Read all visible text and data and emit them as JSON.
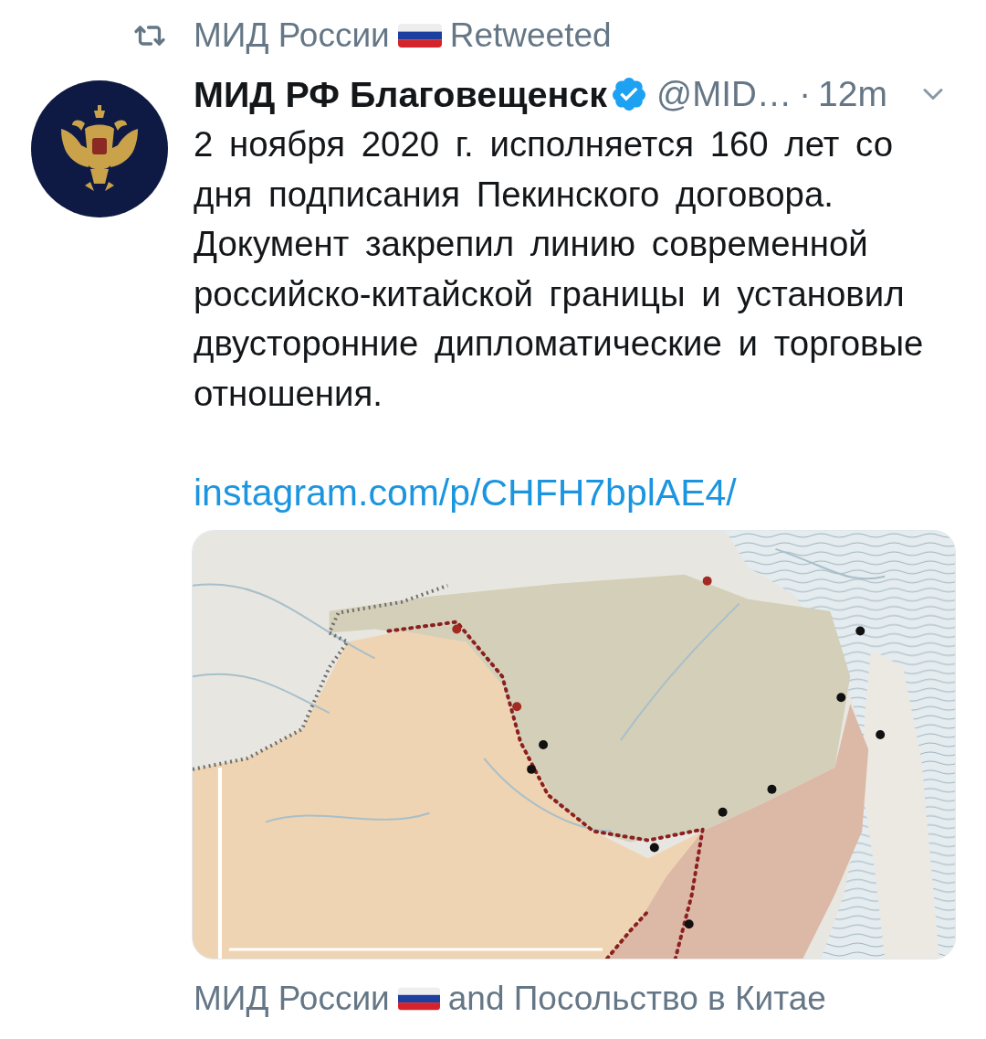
{
  "retweet": {
    "name": "МИД России",
    "label": "Retweeted"
  },
  "tweet": {
    "author": {
      "name": "МИД РФ Благовещенск",
      "verified": true,
      "handle": "@MID…"
    },
    "separator": "·",
    "time": "12m",
    "text": "2 ноября 2020 г. исполняется 160 лет со дня подписания Пекинского договора. Документ закрепил линию современной российско-китайской границы и установил двусторонние дипломатические и торговые отношения.",
    "link": "instagram.com/p/CHFH7bplAE4/"
  },
  "tagged": {
    "name": "МИД России",
    "rest": "and Посольство в Китае"
  }
}
